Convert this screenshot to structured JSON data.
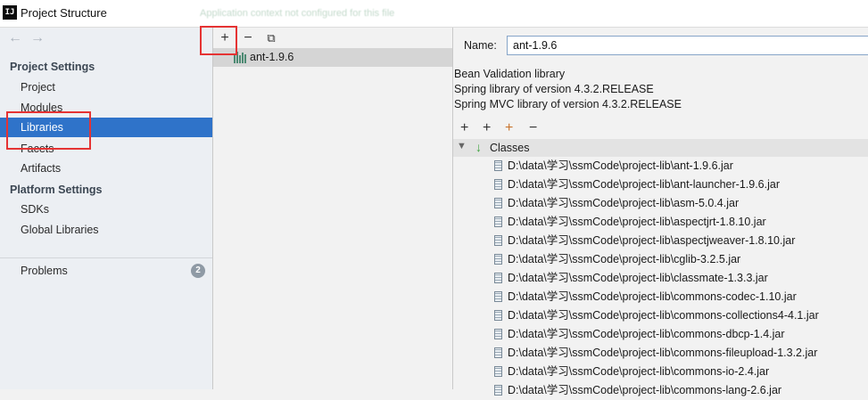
{
  "window": {
    "title": "Project Structure",
    "app_icon": "IJ",
    "ghost_text": "Application context not configured for this file"
  },
  "nav": {
    "back_icon": "←",
    "forward_icon": "→"
  },
  "sidebar": {
    "project_settings_heading": "Project Settings",
    "platform_settings_heading": "Platform Settings",
    "items": [
      {
        "label": "Project"
      },
      {
        "label": "Modules"
      },
      {
        "label": "Libraries",
        "selected": true
      },
      {
        "label": "Facets"
      },
      {
        "label": "Artifacts"
      },
      {
        "label": "SDKs"
      },
      {
        "label": "Global Libraries"
      },
      {
        "label": "Problems",
        "badge": "2"
      }
    ]
  },
  "libraries_toolbar": {
    "add": "+",
    "remove": "−",
    "copy": "⧉"
  },
  "libraries": [
    {
      "label": "ant-1.9.6"
    }
  ],
  "details": {
    "name_label": "Name:",
    "name_value": "ant-1.9.6",
    "descriptions": [
      "Bean Validation library",
      "Spring library of version 4.3.2.RELEASE",
      "Spring MVC library of version 4.3.2.RELEASE"
    ],
    "toolbar": {
      "add": "+",
      "add_roots": "+",
      "add_jar": "+",
      "remove": "−"
    },
    "classes_label": "Classes",
    "jars": [
      "D:\\data\\学习\\ssmCode\\project-lib\\ant-1.9.6.jar",
      "D:\\data\\学习\\ssmCode\\project-lib\\ant-launcher-1.9.6.jar",
      "D:\\data\\学习\\ssmCode\\project-lib\\asm-5.0.4.jar",
      "D:\\data\\学习\\ssmCode\\project-lib\\aspectjrt-1.8.10.jar",
      "D:\\data\\学习\\ssmCode\\project-lib\\aspectjweaver-1.8.10.jar",
      "D:\\data\\学习\\ssmCode\\project-lib\\cglib-3.2.5.jar",
      "D:\\data\\学习\\ssmCode\\project-lib\\classmate-1.3.3.jar",
      "D:\\data\\学习\\ssmCode\\project-lib\\commons-codec-1.10.jar",
      "D:\\data\\学习\\ssmCode\\project-lib\\commons-collections4-4.1.jar",
      "D:\\data\\学习\\ssmCode\\project-lib\\commons-dbcp-1.4.jar",
      "D:\\data\\学习\\ssmCode\\project-lib\\commons-fileupload-1.3.2.jar",
      "D:\\data\\学习\\ssmCode\\project-lib\\commons-io-2.4.jar",
      "D:\\data\\学习\\ssmCode\\project-lib\\commons-lang-2.6.jar"
    ]
  },
  "colors": {
    "selection": "#2f73c9",
    "highlight_box": "#e53333"
  }
}
